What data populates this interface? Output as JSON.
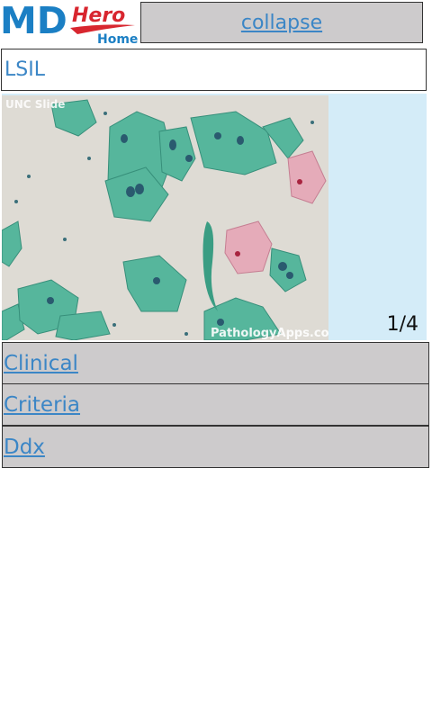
{
  "header": {
    "logo": {
      "text_md": "MD",
      "text_hero": "Hero",
      "text_home": "Home"
    },
    "collapse_label": "collapse"
  },
  "diagnosis": {
    "title": "LSIL"
  },
  "image_viewer": {
    "watermark_top": "UNC Slide",
    "watermark_bottom": "PathologyApps.com",
    "counter": "1/4"
  },
  "sections": [
    {
      "label": "Clinical"
    },
    {
      "label": "Criteria"
    },
    {
      "label": "Ddx"
    }
  ],
  "colors": {
    "link": "#3b86c6",
    "button_bg": "#cdcbcc",
    "panel_bg": "#d4ecf8",
    "logo_blue": "#1b7fc4",
    "logo_red": "#d8262f"
  }
}
